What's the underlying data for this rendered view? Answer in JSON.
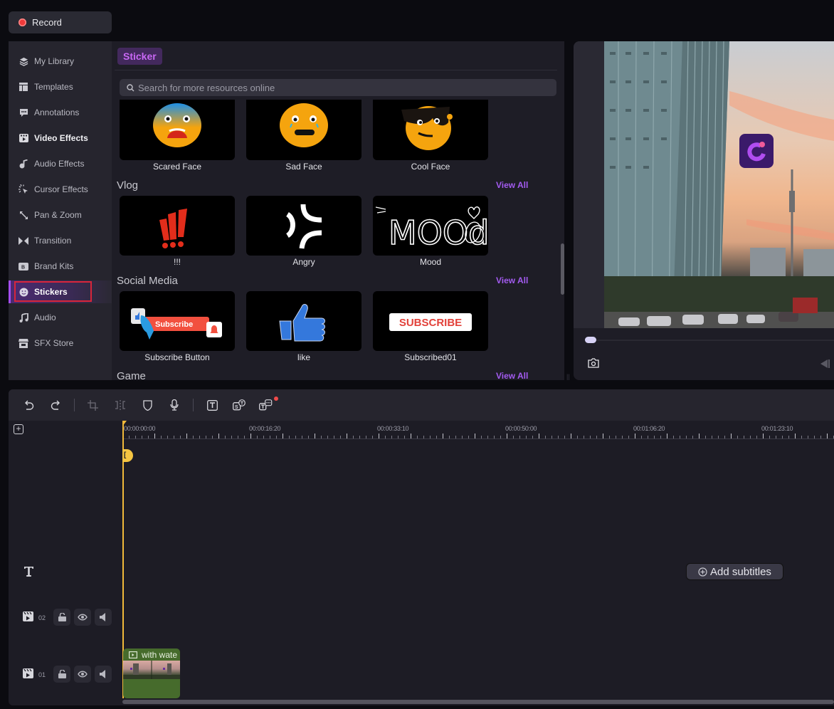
{
  "record": {
    "label": "Record"
  },
  "sidebar": {
    "items": [
      {
        "label": "My Library",
        "icon": "layers-icon"
      },
      {
        "label": "Templates",
        "icon": "template-icon"
      },
      {
        "label": "Annotations",
        "icon": "annotation-icon"
      },
      {
        "label": "Video Effects",
        "icon": "video-effects-icon"
      },
      {
        "label": "Audio Effects",
        "icon": "audio-effects-icon"
      },
      {
        "label": "Cursor Effects",
        "icon": "cursor-effects-icon"
      },
      {
        "label": "Pan & Zoom",
        "icon": "pan-zoom-icon"
      },
      {
        "label": "Transition",
        "icon": "transition-icon"
      },
      {
        "label": "Brand Kits",
        "icon": "brand-kits-icon"
      },
      {
        "label": "Stickers",
        "icon": "sticker-icon"
      },
      {
        "label": "Audio",
        "icon": "music-icon"
      },
      {
        "label": "SFX Store",
        "icon": "store-icon"
      }
    ],
    "active": "Stickers"
  },
  "library": {
    "tab": "Sticker",
    "search_placeholder": "Search for more resources online",
    "view_all": "View All",
    "top_row": [
      {
        "label": "Scared Face"
      },
      {
        "label": "Sad Face"
      },
      {
        "label": "Cool Face"
      }
    ],
    "sections": [
      {
        "title": "Vlog",
        "items": [
          {
            "label": "!!!"
          },
          {
            "label": "Angry"
          },
          {
            "label": "Mood"
          }
        ]
      },
      {
        "title": "Social Media",
        "items": [
          {
            "label": "Subscribe Button"
          },
          {
            "label": "like"
          },
          {
            "label": "Subscribed01"
          }
        ]
      },
      {
        "title": "Game",
        "items": []
      }
    ],
    "thumb_texts": {
      "subscribe_small": "Subscribe",
      "subscribe_big": "SUBSCRIBE",
      "mood": "MOOd"
    }
  },
  "preview": {
    "progress": 0
  },
  "timeline": {
    "toolbar": [
      "undo-icon",
      "redo-icon",
      "crop-icon",
      "split-icon",
      "shield-icon",
      "microphone-icon",
      "text-icon",
      "speech-to-text-icon",
      "text-to-speech-icon"
    ],
    "ruler_labels": [
      "00:00:00:00",
      "00:00:16:20",
      "00:00:33:10",
      "00:00:50:00",
      "00:01:06:20",
      "00:01:23:10"
    ],
    "tracks": [
      {
        "number": "02"
      },
      {
        "number": "01"
      }
    ],
    "add_subtitles": "Add subtitles",
    "clip": {
      "label": "with wate"
    },
    "accent": "#f0b93a"
  },
  "colors": {
    "accent_purple": "#a35bf0",
    "record_red": "#f03a3a",
    "highlight_red": "#d8253a"
  }
}
